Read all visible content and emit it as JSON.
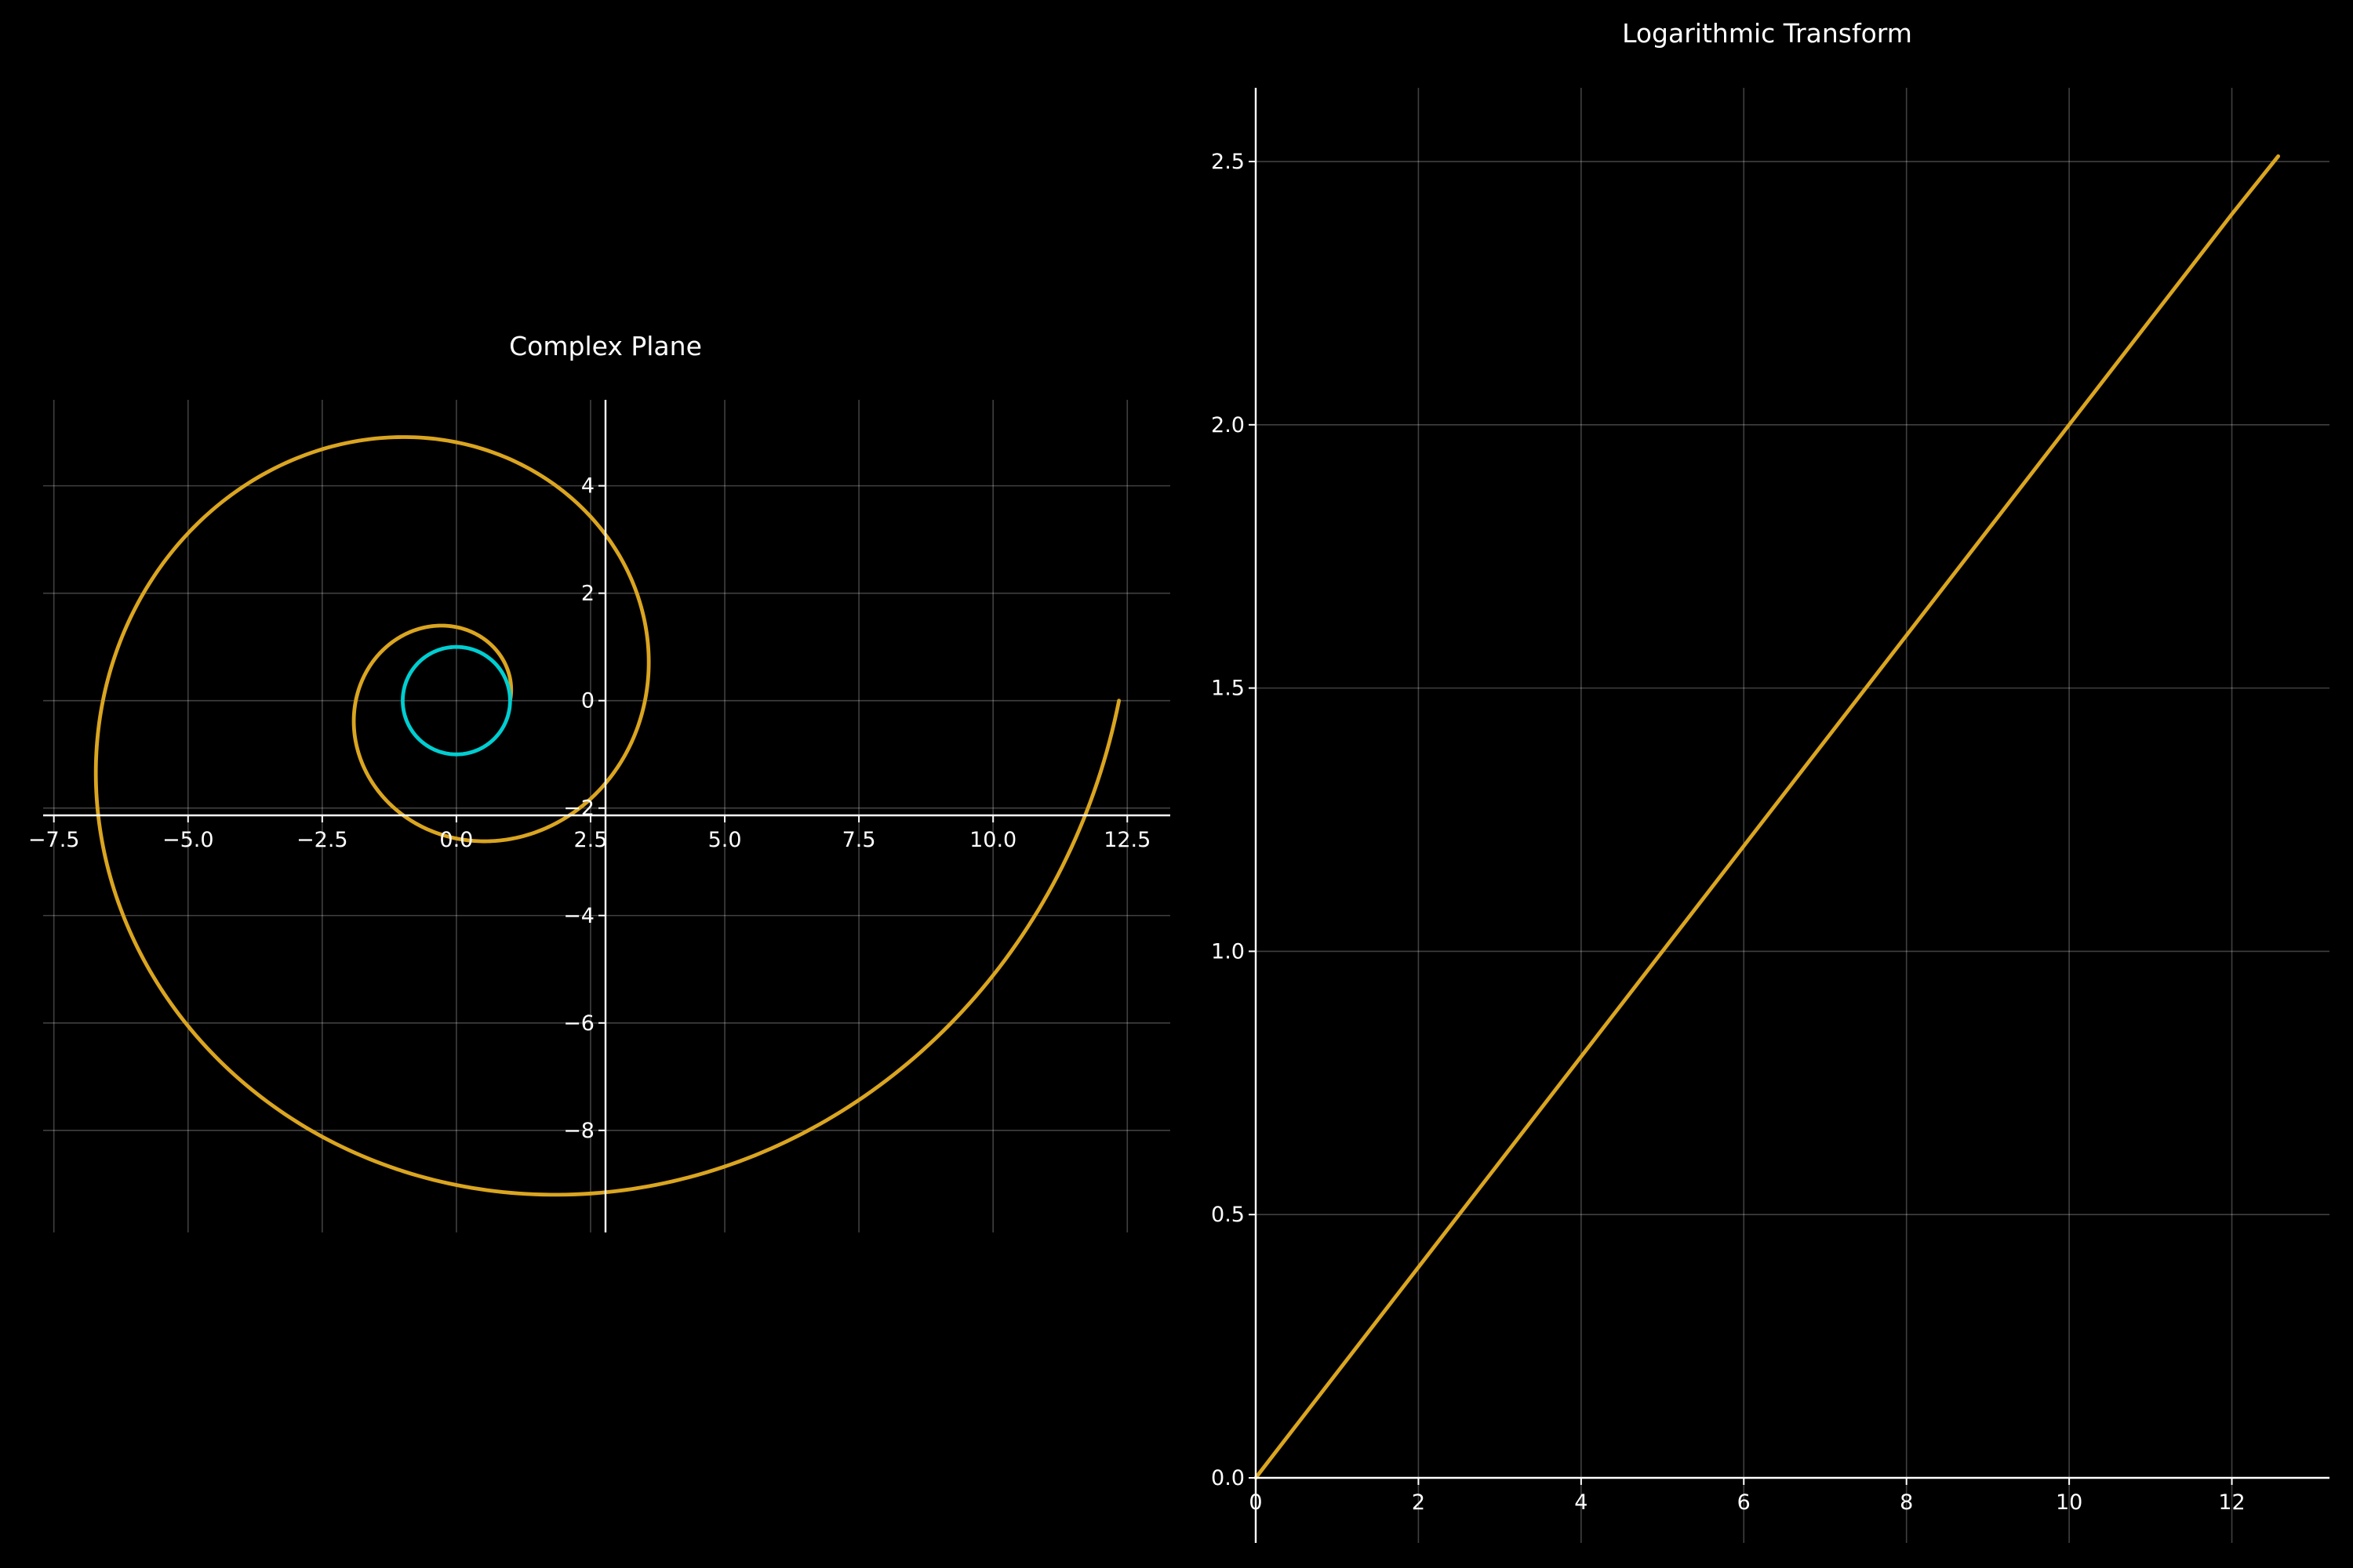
{
  "colors": {
    "background": "#000000",
    "spiral": "#daa520",
    "circle": "#00ced1",
    "text": "#ffffff"
  },
  "chart_data": [
    {
      "type": "line",
      "title": "Complex Plane",
      "xlabel": "",
      "ylabel": "",
      "xlim": [
        -7.7,
        13.3
      ],
      "ylim": [
        -9.9,
        5.6
      ],
      "x_ticks": [
        -7.5,
        -5.0,
        -2.5,
        0.0,
        2.5,
        5.0,
        7.5,
        10.0,
        12.5
      ],
      "x_tick_labels": [
        "−7.5",
        "−5.0",
        "−2.5",
        "0.0",
        "2.5",
        "5.0",
        "7.5",
        "10.0",
        "12.5"
      ],
      "y_ticks": [
        -8,
        -6,
        -4,
        -2,
        0,
        2,
        4
      ],
      "y_tick_labels": [
        "−8",
        "−6",
        "−4",
        "−2",
        "0",
        "2",
        "4"
      ],
      "grid": true,
      "spines": "centered",
      "series": [
        {
          "kind": "spiral",
          "formula": "r = e^(0.2*theta), theta from 0 to 4*pi",
          "points": [
            [
              1.0,
              0.0
            ],
            [
              0.0,
              1.37
            ],
            [
              -1.87,
              0.0
            ],
            [
              0.0,
              -2.57
            ],
            [
              3.51,
              0.0
            ],
            [
              0.0,
              4.81
            ],
            [
              -6.59,
              0.0
            ],
            [
              0.0,
              -9.02
            ],
            [
              12.35,
              0.0
            ]
          ],
          "color": "#daa520"
        },
        {
          "kind": "unit-circle",
          "center": [
            0,
            0
          ],
          "radius": 1,
          "color": "#00ced1"
        }
      ]
    },
    {
      "type": "line",
      "title": "Logarithmic Transform",
      "xlabel": "",
      "ylabel": "",
      "xlim": [
        0,
        13.2
      ],
      "ylim": [
        0,
        2.64
      ],
      "x_ticks": [
        0,
        2,
        4,
        6,
        8,
        10,
        12
      ],
      "x_tick_labels": [
        "0",
        "2",
        "4",
        "6",
        "8",
        "10",
        "12"
      ],
      "y_ticks": [
        0.0,
        0.5,
        1.0,
        1.5,
        2.0,
        2.5
      ],
      "y_tick_labels": [
        "0.0",
        "0.5",
        "1.0",
        "1.5",
        "2.0",
        "2.5"
      ],
      "grid": true,
      "series": [
        {
          "kind": "line",
          "x": [
            0,
            2,
            4,
            6,
            8,
            10,
            12,
            12.57
          ],
          "y": [
            0.0,
            0.4,
            0.8,
            1.2,
            1.6,
            2.0,
            2.4,
            2.51
          ],
          "color": "#daa520"
        }
      ]
    }
  ]
}
